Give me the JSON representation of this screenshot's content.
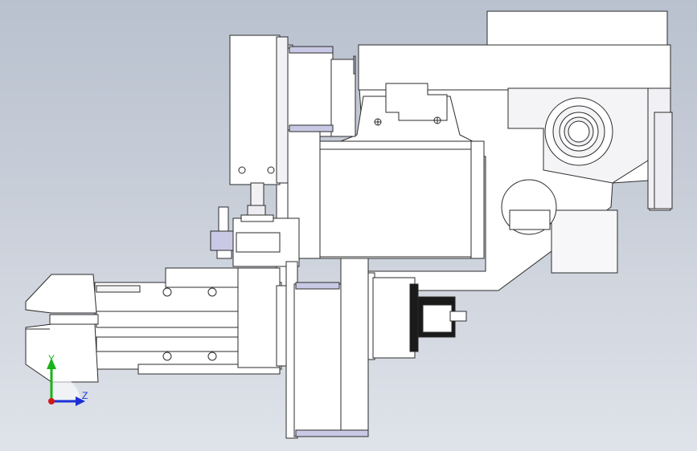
{
  "view": {
    "background_top": "#b9c1cf",
    "background_bottom": "#dfe3ea",
    "part_fill": "#ffffff",
    "part_shade": "#e6e6ec",
    "accent_fill": "#c9c9e6",
    "line_color": "#2b2b2b"
  },
  "triad": {
    "y_label": "Y",
    "z_label": "Z",
    "y_color": "#19b319",
    "z_color": "#1a2fd6",
    "x_color": "#d11919"
  }
}
